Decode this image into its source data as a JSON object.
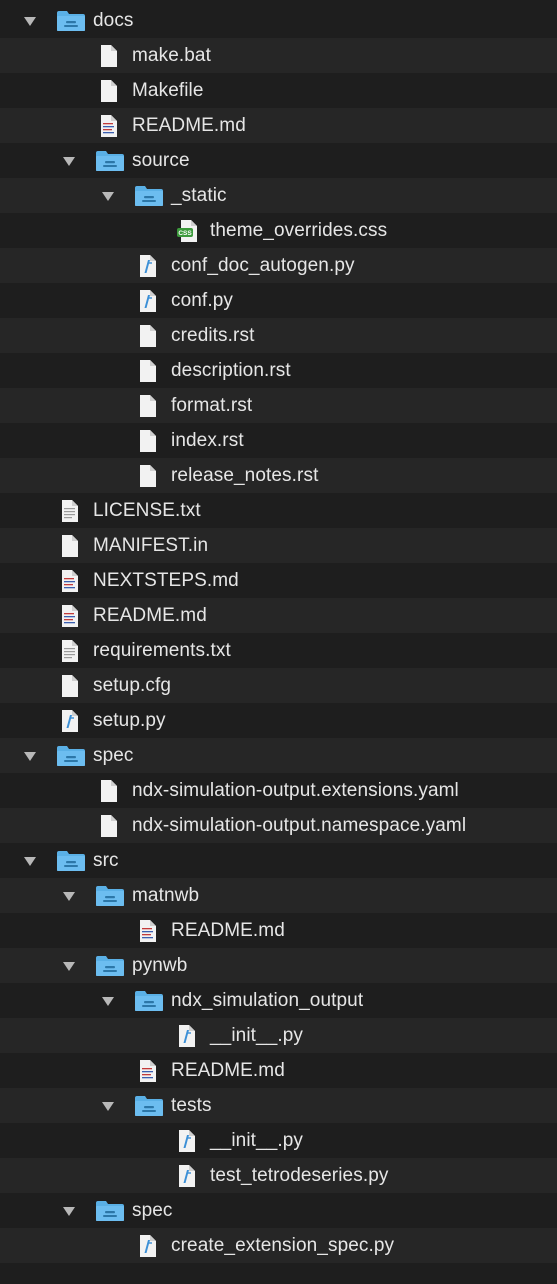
{
  "colors": {
    "background": "#1e1e1e",
    "row_alt": "#262626",
    "text": "#e6e6e6",
    "folder": "#5ab0e6",
    "chevron": "#b8b8b8"
  },
  "tree": [
    {
      "label": "docs",
      "depth": 0,
      "type": "folder",
      "expanded": true,
      "icon": "folder-icon"
    },
    {
      "label": "make.bat",
      "depth": 1,
      "type": "file",
      "icon": "file-icon"
    },
    {
      "label": "Makefile",
      "depth": 1,
      "type": "file",
      "icon": "file-icon"
    },
    {
      "label": "README.md",
      "depth": 1,
      "type": "file",
      "icon": "markdown-file-icon"
    },
    {
      "label": "source",
      "depth": 1,
      "type": "folder",
      "expanded": true,
      "icon": "folder-icon"
    },
    {
      "label": "_static",
      "depth": 2,
      "type": "folder",
      "expanded": true,
      "icon": "folder-icon"
    },
    {
      "label": "theme_overrides.css",
      "depth": 3,
      "type": "file",
      "icon": "css-file-icon"
    },
    {
      "label": "conf_doc_autogen.py",
      "depth": 2,
      "type": "file",
      "icon": "python-file-icon"
    },
    {
      "label": "conf.py",
      "depth": 2,
      "type": "file",
      "icon": "python-file-icon"
    },
    {
      "label": "credits.rst",
      "depth": 2,
      "type": "file",
      "icon": "file-icon"
    },
    {
      "label": "description.rst",
      "depth": 2,
      "type": "file",
      "icon": "file-icon"
    },
    {
      "label": "format.rst",
      "depth": 2,
      "type": "file",
      "icon": "file-icon"
    },
    {
      "label": "index.rst",
      "depth": 2,
      "type": "file",
      "icon": "file-icon"
    },
    {
      "label": "release_notes.rst",
      "depth": 2,
      "type": "file",
      "icon": "file-icon"
    },
    {
      "label": "LICENSE.txt",
      "depth": 0,
      "type": "file",
      "icon": "text-file-icon"
    },
    {
      "label": "MANIFEST.in",
      "depth": 0,
      "type": "file",
      "icon": "file-icon"
    },
    {
      "label": "NEXTSTEPS.md",
      "depth": 0,
      "type": "file",
      "icon": "markdown-file-icon"
    },
    {
      "label": "README.md",
      "depth": 0,
      "type": "file",
      "icon": "markdown-file-icon"
    },
    {
      "label": "requirements.txt",
      "depth": 0,
      "type": "file",
      "icon": "text-file-icon"
    },
    {
      "label": "setup.cfg",
      "depth": 0,
      "type": "file",
      "icon": "file-icon"
    },
    {
      "label": "setup.py",
      "depth": 0,
      "type": "file",
      "icon": "python-file-icon"
    },
    {
      "label": "spec",
      "depth": 0,
      "type": "folder",
      "expanded": true,
      "icon": "folder-icon"
    },
    {
      "label": "ndx-simulation-output.extensions.yaml",
      "depth": 1,
      "type": "file",
      "icon": "file-icon"
    },
    {
      "label": "ndx-simulation-output.namespace.yaml",
      "depth": 1,
      "type": "file",
      "icon": "file-icon"
    },
    {
      "label": "src",
      "depth": 0,
      "type": "folder",
      "expanded": true,
      "icon": "folder-icon"
    },
    {
      "label": "matnwb",
      "depth": 1,
      "type": "folder",
      "expanded": true,
      "icon": "folder-icon"
    },
    {
      "label": "README.md",
      "depth": 2,
      "type": "file",
      "icon": "markdown-file-icon"
    },
    {
      "label": "pynwb",
      "depth": 1,
      "type": "folder",
      "expanded": true,
      "icon": "folder-icon"
    },
    {
      "label": "ndx_simulation_output",
      "depth": 2,
      "type": "folder",
      "expanded": true,
      "icon": "folder-icon"
    },
    {
      "label": "__init__.py",
      "depth": 3,
      "type": "file",
      "icon": "python-file-icon"
    },
    {
      "label": "README.md",
      "depth": 2,
      "type": "file",
      "icon": "markdown-file-icon"
    },
    {
      "label": "tests",
      "depth": 2,
      "type": "folder",
      "expanded": true,
      "icon": "folder-icon"
    },
    {
      "label": "__init__.py",
      "depth": 3,
      "type": "file",
      "icon": "python-file-icon"
    },
    {
      "label": "test_tetrodeseries.py",
      "depth": 3,
      "type": "file",
      "icon": "python-file-icon"
    },
    {
      "label": "spec",
      "depth": 1,
      "type": "folder",
      "expanded": true,
      "icon": "folder-icon"
    },
    {
      "label": "create_extension_spec.py",
      "depth": 2,
      "type": "file",
      "icon": "python-file-icon"
    }
  ]
}
